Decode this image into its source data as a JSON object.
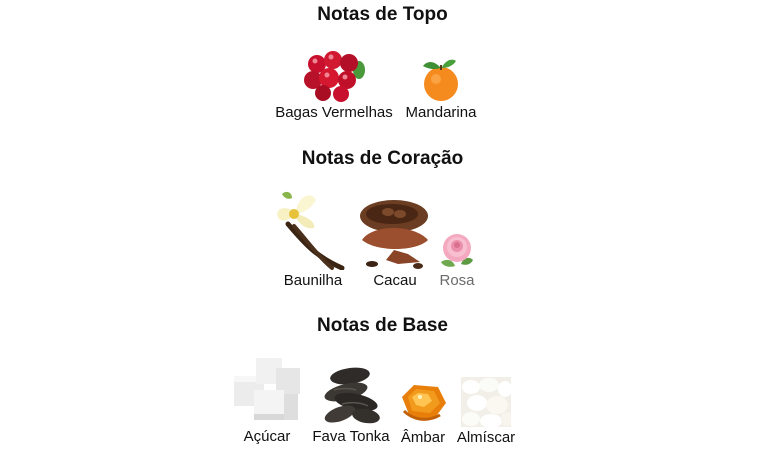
{
  "sections": [
    {
      "title": "Notas de Topo",
      "notes": [
        {
          "label": "Bagas Vermelhas",
          "icon": "red-berries-icon"
        },
        {
          "label": "Mandarina",
          "icon": "mandarin-icon"
        }
      ]
    },
    {
      "title": "Notas de Coração",
      "notes": [
        {
          "label": "Baunilha",
          "icon": "vanilla-icon"
        },
        {
          "label": "Cacau",
          "icon": "cocoa-icon"
        },
        {
          "label": "Rosa",
          "icon": "rose-icon"
        }
      ]
    },
    {
      "title": "Notas de Base",
      "notes": [
        {
          "label": "Açúcar",
          "icon": "sugar-cubes-icon"
        },
        {
          "label": "Fava Tonka",
          "icon": "tonka-bean-icon"
        },
        {
          "label": "Âmbar",
          "icon": "amber-icon"
        },
        {
          "label": "Almíscar",
          "icon": "musk-icon"
        }
      ]
    }
  ]
}
